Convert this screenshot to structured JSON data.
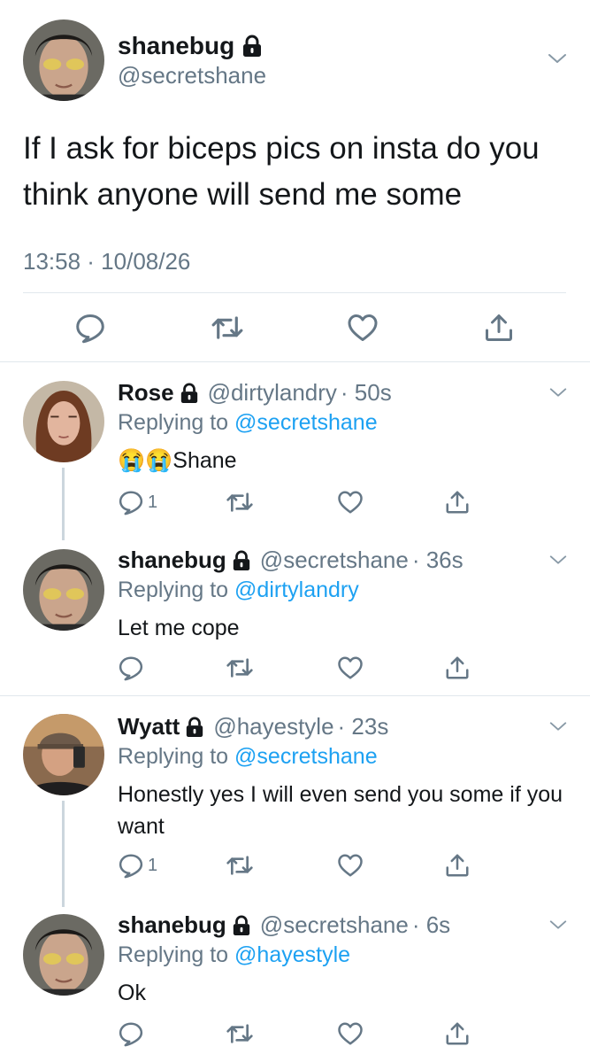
{
  "main_tweet": {
    "name": "shanebug",
    "handle": "@secretshane",
    "text": "If I ask for biceps pics on insta do you think anyone will send me some",
    "timestamp": "13:58 · 10/08/26"
  },
  "replies": [
    {
      "name": "Rose",
      "handle": "@dirtylandry",
      "time": "· 50s",
      "replying_prefix": "Replying to",
      "replying_to": "@secretshane",
      "text": "Shane",
      "emoji": "😭😭",
      "reply_count": "1"
    },
    {
      "name": "shanebug",
      "handle": "@secretshane",
      "time": "· 36s",
      "replying_prefix": "Replying to",
      "replying_to": "@dirtylandry",
      "text": "Let me cope",
      "reply_count": ""
    },
    {
      "name": "Wyatt",
      "handle": "@hayestyle",
      "time": "· 23s",
      "replying_prefix": "Replying to",
      "replying_to": "@secretshane",
      "text": "Honestly yes I will even send you some if you want",
      "reply_count": "1"
    },
    {
      "name": "shanebug",
      "handle": "@secretshane",
      "time": "· 6s",
      "replying_prefix": "Replying to",
      "replying_to": "@hayestyle",
      "text": "Ok",
      "reply_count": ""
    }
  ],
  "icons": [
    "lock-icon",
    "chevron-down-icon",
    "reply-icon",
    "retweet-icon",
    "like-icon",
    "share-icon",
    "crying-face-emoji"
  ],
  "colors": {
    "text": "#14171a",
    "secondary": "#657786",
    "link": "#1da1f2",
    "divider": "#e1e8ed",
    "thread": "#ccd6dd"
  }
}
